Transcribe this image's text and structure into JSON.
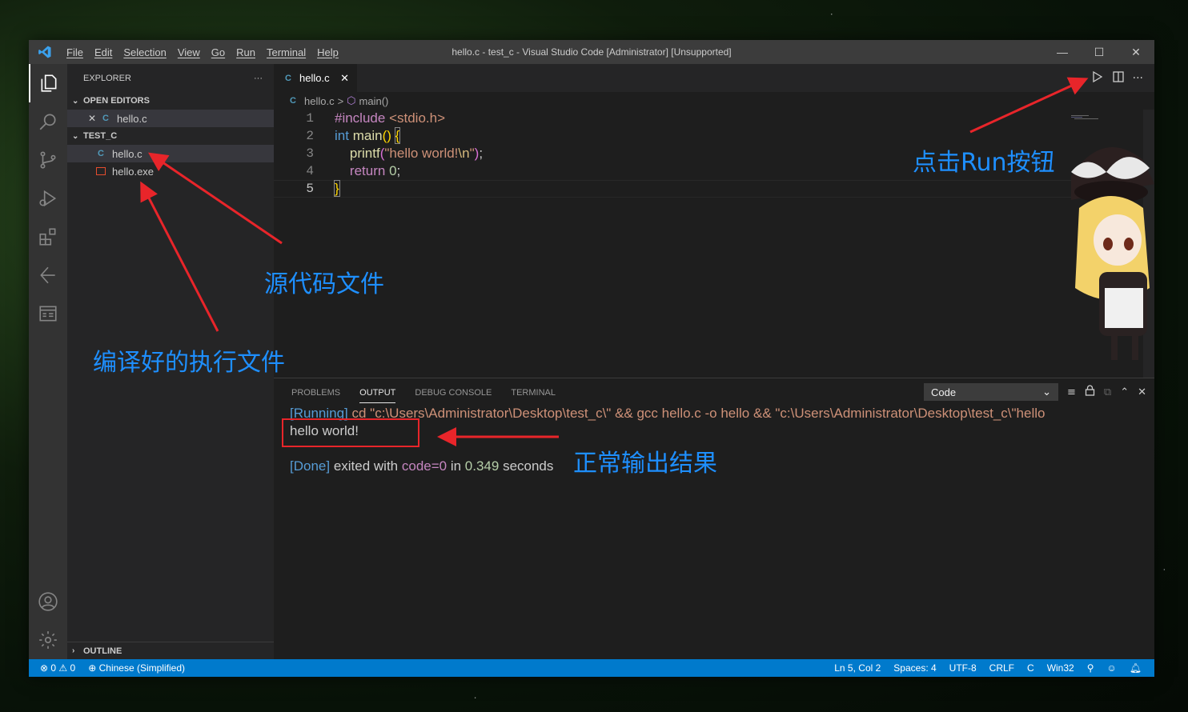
{
  "window": {
    "title": "hello.c - test_c - Visual Studio Code [Administrator] [Unsupported]",
    "menu": [
      "File",
      "Edit",
      "Selection",
      "View",
      "Go",
      "Run",
      "Terminal",
      "Help"
    ],
    "minimize": "—",
    "maximize": "☐",
    "close": "✕"
  },
  "sidebar": {
    "header": "EXPLORER",
    "more": "···",
    "open_editors": {
      "label": "OPEN EDITORS",
      "items": [
        {
          "close": "✕",
          "badge": "C",
          "name": "hello.c"
        }
      ]
    },
    "folder": {
      "label": "TEST_C",
      "items": [
        {
          "badge": "C",
          "name": "hello.c"
        },
        {
          "badge": "exe",
          "name": "hello.exe"
        }
      ]
    },
    "outline": "OUTLINE"
  },
  "editor": {
    "tab": {
      "badge": "C",
      "name": "hello.c",
      "close": "✕"
    },
    "breadcrumb": {
      "badge": "C",
      "file": "hello.c",
      "sep": ">",
      "symbol": "main()"
    },
    "lines": [
      {
        "n": "1",
        "text": "#include <stdio.h>"
      },
      {
        "n": "2",
        "text": "int main() {"
      },
      {
        "n": "3",
        "text": "    printf(\"hello world!\\n\");"
      },
      {
        "n": "4",
        "text": "    return 0;"
      },
      {
        "n": "5",
        "text": "}"
      }
    ]
  },
  "panel": {
    "tabs": [
      "PROBLEMS",
      "OUTPUT",
      "DEBUG CONSOLE",
      "TERMINAL"
    ],
    "active_tab": "OUTPUT",
    "channel": "Code",
    "output": {
      "running_tag": "[Running]",
      "command": " cd \"c:\\Users\\Administrator\\Desktop\\test_c\\\" && gcc hello.c -o hello && \"c:\\Users\\Administrator\\Desktop\\test_c\\\"hello",
      "result": "hello world!",
      "done_tag": "[Done]",
      "exited": " exited with ",
      "code": "code=0",
      "in": " in ",
      "seconds": "0.349",
      "seconds_label": " seconds"
    }
  },
  "statusbar": {
    "errors": "0",
    "warnings": "0",
    "language_pack": "Chinese (Simplified)",
    "position": "Ln 5, Col 2",
    "spaces": "Spaces: 4",
    "encoding": "UTF-8",
    "eol": "CRLF",
    "language": "C",
    "platform": "Win32"
  },
  "annotations": {
    "run_button": "点击Run按钮",
    "source_file": "源代码文件",
    "compiled_file": "编译好的执行文件",
    "output_result": "正常输出结果"
  },
  "colors": {
    "accent": "#007acc",
    "annotation_text": "#1e8fff",
    "annotation_red": "#e8252a"
  }
}
